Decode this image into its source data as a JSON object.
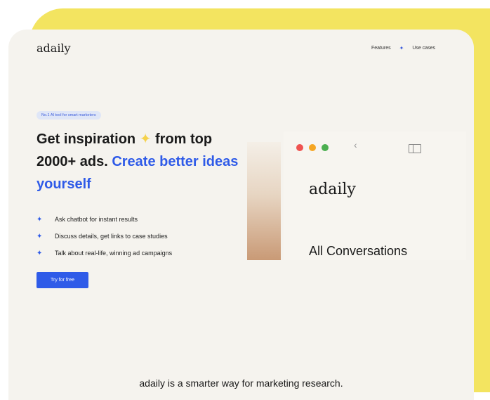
{
  "header": {
    "logo": "adaily",
    "nav": [
      "Features",
      "Use cases"
    ]
  },
  "hero": {
    "badge": "No.1 AI tool for smart marketers",
    "headline_part1": "Get inspiration",
    "headline_sparkle": "✦",
    "headline_part2": "from top 2000+ ads.",
    "headline_blue": "Create better ideas yourself",
    "bullets": [
      "Ask chatbot for instant results",
      "Discuss details, get links to case studies",
      "Talk about real-life, winning ad campaigns"
    ],
    "cta_label": "Try for free"
  },
  "preview": {
    "logo": "adaily",
    "title": "All Conversations"
  },
  "footer": {
    "tagline": "adaily is a smarter way for marketing research."
  },
  "colors": {
    "accent": "#2f5be8",
    "yellow": "#f3e460",
    "card_bg": "#f5f3ee"
  }
}
